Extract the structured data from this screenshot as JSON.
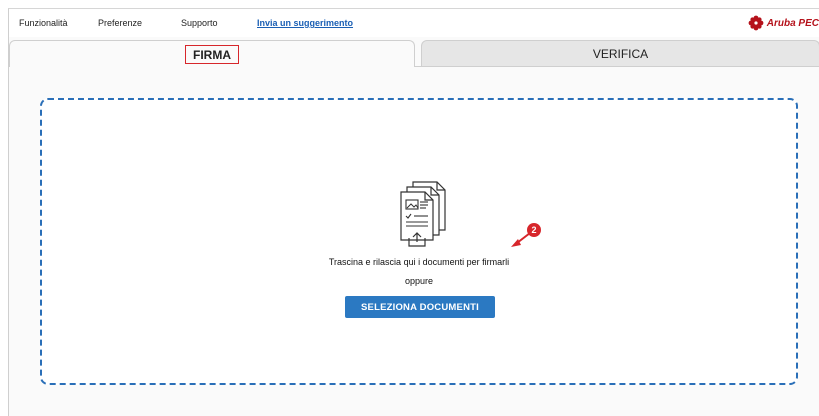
{
  "menubar": {
    "items": [
      {
        "label": "Funzionalità"
      },
      {
        "label": "Preferenze"
      },
      {
        "label": "Supporto"
      }
    ],
    "feedback_link": "Invia un suggerimento",
    "brand": "Aruba PEC",
    "brand_color": "#b5121b"
  },
  "tabs": {
    "sign": "FIRMA",
    "verify": "VERIFICA",
    "active": "FIRMA"
  },
  "drop_zone": {
    "icon": "documents-upload-icon",
    "instruction": "Trascina e rilascia qui i documenti per firmarli",
    "or_text": "oppure",
    "button_label": "SELEZIONA DOCUMENTI",
    "border_color": "#2a6fb8"
  },
  "annotation": {
    "badge": "2",
    "color": "#d7262b"
  }
}
